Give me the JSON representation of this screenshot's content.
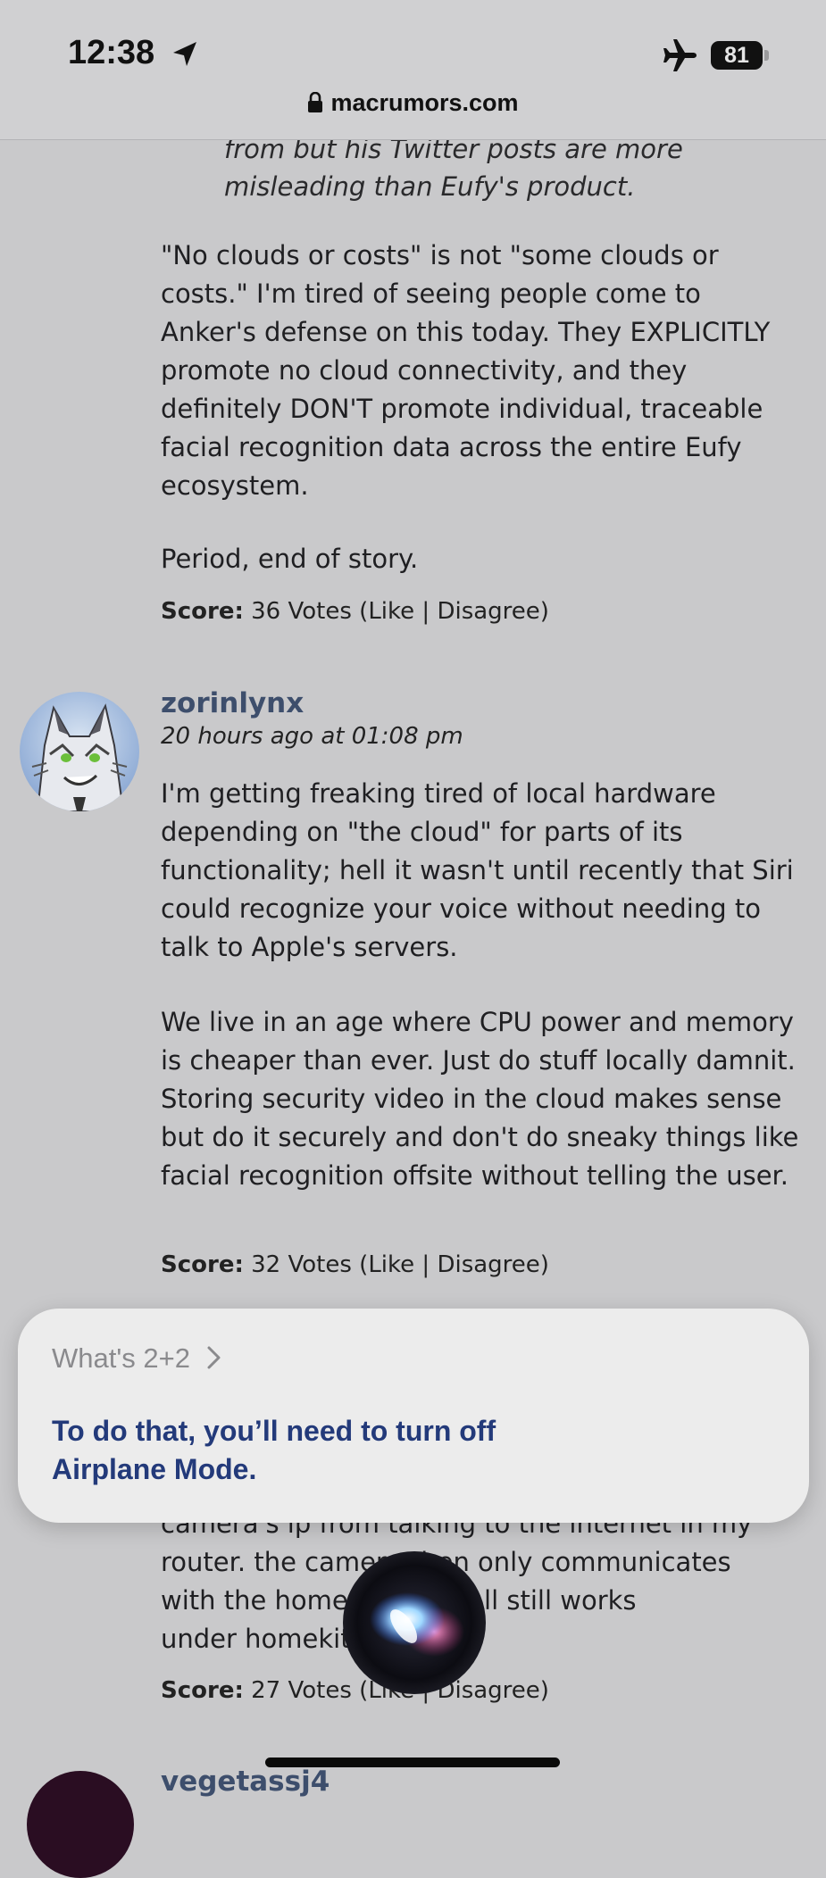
{
  "status_bar": {
    "time": "12:38",
    "battery": "81",
    "icons": [
      "location-arrow-icon",
      "airplane-icon",
      "battery-icon"
    ]
  },
  "url_bar": {
    "domain": "macrumors.com",
    "icon": "lock-icon"
  },
  "posts": [
    {
      "quote_lines": [
        "from but his Twitter posts are more",
        "misleading than Eufy's product."
      ],
      "paragraph1": "\"No clouds or costs\" is not \"some clouds or costs.\" I'm tired of seeing people come to Anker's defense on this today. They EXPLICITLY promote no cloud connectivity, and they definitely DON'T promote individual, traceable facial recognition data across the entire Eufy ecosystem.",
      "paragraph2": "Period, end of story.",
      "score_label": "Score:",
      "score_votes": "36 Votes",
      "like_label": "Like",
      "disagree_label": "Disagree"
    },
    {
      "username": "zorinlynx",
      "time": "20 hours ago at 01:08 pm",
      "paragraph1": "I'm getting freaking tired of local hardware depending on \"the cloud\" for parts of its functionality; hell it wasn't until recently that Siri could recognize your voice without needing to talk to Apple's servers.",
      "paragraph2": "We live in an age where CPU power and memory is cheaper than ever. Just do stuff locally damnit. Storing security video in the cloud makes sense but do it securely and don't do sneaky things like facial recognition offsite without telling the user.",
      "score_label": "Score:",
      "score_votes": "32 Votes",
      "like_label": "Like",
      "disagree_label": "Disagree"
    },
    {
      "lines": [
        "camera's ip from talking to the internet in my",
        "router. the camera then only communicates",
        "with the homepod so it all still works",
        "under homekit"
      ],
      "score_label": "Score:",
      "score_votes": "27 Votes",
      "like_label": "Like",
      "disagree_label": "Disagree"
    },
    {
      "username": "vegetassj4"
    }
  ],
  "siri": {
    "query": "What's 2+2",
    "answer": "To do that, you’ll need to turn off Airplane Mode."
  },
  "colors": {
    "background": "#c9c9cb",
    "username": "#3d4e6c",
    "siri_answer": "#233a7a"
  }
}
